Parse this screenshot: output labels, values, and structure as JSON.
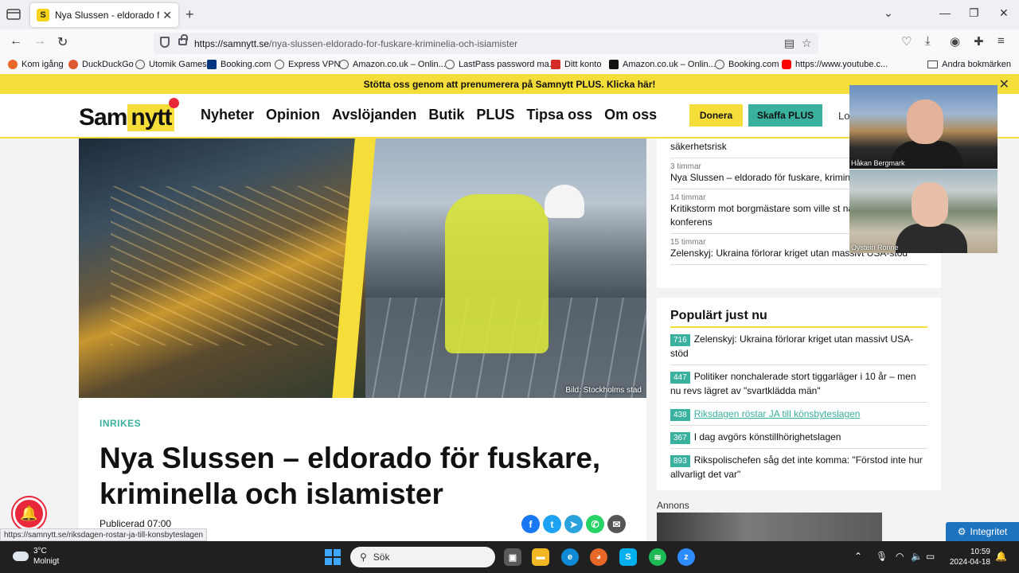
{
  "browser": {
    "tab_title": "Nya Slussen - eldorado för fuskare",
    "tab_favicon": "S",
    "url_host": "https://samnytt.se",
    "url_path": "/nya-slussen-eldorado-for-fuskare-kriminelia-och-isiamister",
    "status_url": "https://samnytt.se/riksdagen-rostar-ja-till-konsbyteslagen",
    "bookmarks": [
      {
        "label": "Kom igång",
        "color": "#e8682a"
      },
      {
        "label": "DuckDuckGo",
        "color": "#de5833"
      },
      {
        "label": "Utomik Games",
        "color": "#555555"
      },
      {
        "label": "Booking.com",
        "color": "#003580"
      },
      {
        "label": "Express VPN",
        "color": "#555555"
      },
      {
        "label": "Amazon.co.uk – Onlin...",
        "color": "#555555"
      },
      {
        "label": "LastPass password ma...",
        "color": "#555555"
      },
      {
        "label": "Ditt konto",
        "color": "#d32d27"
      },
      {
        "label": "Amazon.co.uk – Onlin...",
        "color": "#111111"
      },
      {
        "label": "Booking.com",
        "color": "#555555"
      },
      {
        "label": "https://www.youtube.c...",
        "color": "#ff0000"
      }
    ],
    "other_bookmarks": "Andra bokmärken"
  },
  "promo": {
    "text": "Stötta oss genom att prenumerera på Samnytt PLUS. Klicka här!"
  },
  "site": {
    "logo_left": "Sam",
    "logo_right": "nytt",
    "menu": [
      "Nyheter",
      "Opinion",
      "Avslöjanden",
      "Butik",
      "PLUS",
      "Tipsa oss",
      "Om oss"
    ],
    "donate": "Donera",
    "plus_button": "Skaffa PLUS",
    "login": "Lo",
    "accent": "#f5dd3a",
    "teal": "#3ab09e"
  },
  "hero": {
    "credit": "Bild: Stockholms stad"
  },
  "article": {
    "category": "INRIKES",
    "headline": "Nya Slussen – eldorado för fuskare, kriminella och islamister",
    "published": "Publicerad 07:00"
  },
  "share": [
    {
      "icon": "facebook-icon",
      "glyph": "f",
      "color": "#1877f2"
    },
    {
      "icon": "twitter-icon",
      "glyph": "t",
      "color": "#1da1f2"
    },
    {
      "icon": "telegram-icon",
      "glyph": "➤",
      "color": "#2aa3dd"
    },
    {
      "icon": "whatsapp-icon",
      "glyph": "✆",
      "color": "#25d366"
    },
    {
      "icon": "email-icon",
      "glyph": "✉",
      "color": "#555555"
    }
  ],
  "latest_news": [
    {
      "time": "",
      "title": "säkerhetsrisk"
    },
    {
      "time": "3 timmar",
      "title": "Nya Slussen – eldorado för fuskare, krimin islamister"
    },
    {
      "time": "14 timmar",
      "title": "Kritikstorm mot borgmästare som ville st nationalkonservativ konferens"
    },
    {
      "time": "15 timmar",
      "title": "Zelenskyj: Ukraina förlorar kriget utan massivt USA-stöd"
    }
  ],
  "popular": {
    "heading": "Populärt just nu",
    "items": [
      {
        "count": "716",
        "title": "Zelenskyj: Ukraina förlorar kriget utan massivt USA-stöd",
        "hover": false
      },
      {
        "count": "447",
        "title": "Politiker nonchalerade stort tiggarläger i 10 år – men nu revs lägret av \"svartklädda män\"",
        "hover": false
      },
      {
        "count": "438",
        "title": "Riksdagen röstar JA till könsbyteslagen",
        "hover": true
      },
      {
        "count": "367",
        "title": "I dag avgörs könstillhörighetslagen",
        "hover": false
      },
      {
        "count": "893",
        "title": "Rikspolischefen såg det inte komma: \"Förstod inte hur allvarligt det var\"",
        "hover": false
      }
    ]
  },
  "annons": "Annons",
  "integritet": "Integritet",
  "video": {
    "person1": "Håkan Bergmark",
    "person2": "Oystein Rönne"
  },
  "taskbar": {
    "temp": "3°C",
    "weather": "Molnigt",
    "search": "Sök",
    "time": "10:59",
    "date": "2024-04-18"
  }
}
